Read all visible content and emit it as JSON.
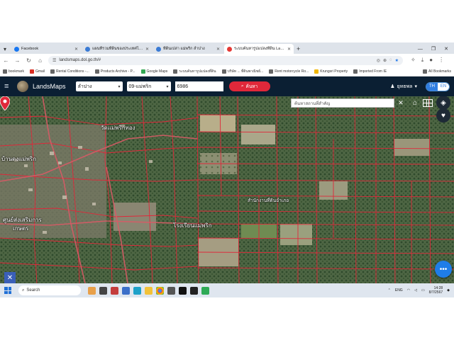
{
  "browser": {
    "tabs": [
      {
        "title": "Facebook",
        "color": "#1877f2",
        "active": false
      },
      {
        "title": "แผนที่รวมที่ดินของประเทศไทย",
        "color": "#3a7bd5",
        "active": false
      },
      {
        "title": "ที่ดินเปล่า แม่พริก ลำปาง",
        "color": "#3a7bd5",
        "active": false
      },
      {
        "title": "ระบบค้นหารูปแปลงที่ดิน LandsMaps",
        "color": "#e53935",
        "active": true
      }
    ],
    "new_tab": "+",
    "url": "landsmaps.dol.go.th/#",
    "bookmarks": [
      {
        "label": "bookmark"
      },
      {
        "label": "Gmail"
      },
      {
        "label": "Rental Conditions -..."
      },
      {
        "label": "Products Archive - P..."
      },
      {
        "label": "Google Maps"
      },
      {
        "label": "ระบบค้นหารูปแปลงที่ดิน"
      },
      {
        "label": "บริษัท ... ที่ดินพาณิชย์..."
      },
      {
        "label": "Rent motorcycle Ro..."
      },
      {
        "label": "Krungsri Property"
      },
      {
        "label": "Imported From IE"
      }
    ],
    "all_bookmarks": "All Bookmarks"
  },
  "app": {
    "brand": "LandsMaps",
    "province": "ลำปาง",
    "office": "09-แม่พริก",
    "parcel_no": "6986",
    "search_label": "ค้นหา",
    "user": "ยุทธพล",
    "lang_on": "TH",
    "lang_off": "EN",
    "place_search_placeholder": "ค้นหาสถานที่สำคัญ"
  },
  "map": {
    "labels": {
      "wat": "วัดแม่พริกทอง",
      "village": "บ้านดงแม่พริก",
      "center1": "ศูนย์ส่งเสริมการ",
      "center2": "เกษตร",
      "school": "โรงเรียนแม่พริก",
      "pin_label": "สำนักงานที่ดินอำเภอ"
    },
    "parcel_line_color": "#e0283a",
    "pin_color": "#e0283a"
  },
  "taskbar": {
    "search": "Search",
    "lang": "ENG",
    "time": "14:28",
    "date": "8/7/2567"
  }
}
